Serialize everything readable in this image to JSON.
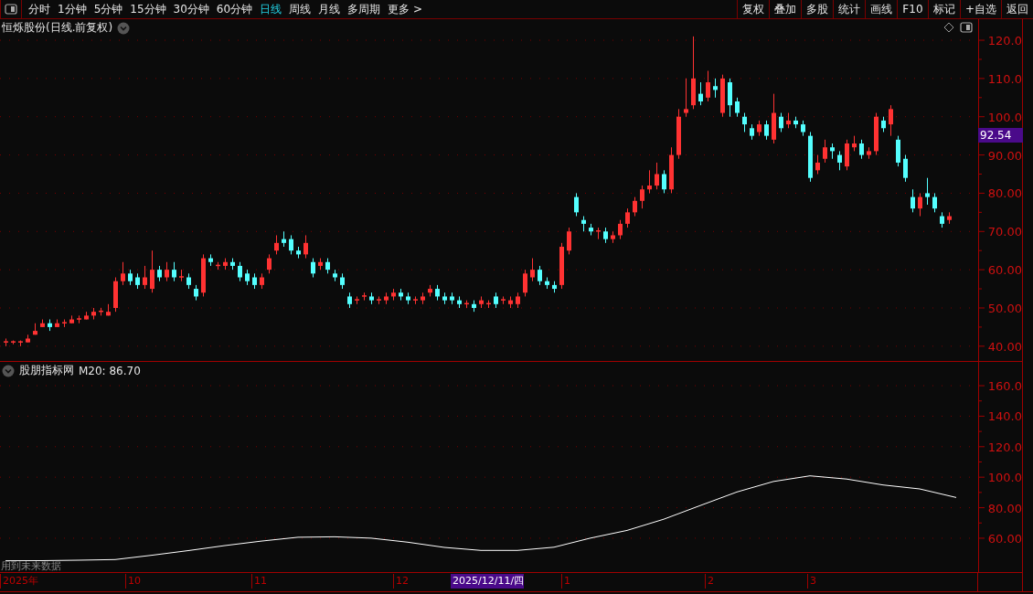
{
  "toolbar": {
    "periods": [
      {
        "label": "分时",
        "selected": false
      },
      {
        "label": "1分钟",
        "selected": false
      },
      {
        "label": "5分钟",
        "selected": false
      },
      {
        "label": "15分钟",
        "selected": false
      },
      {
        "label": "30分钟",
        "selected": false
      },
      {
        "label": "60分钟",
        "selected": false
      },
      {
        "label": "日线",
        "selected": true
      },
      {
        "label": "周线",
        "selected": false
      },
      {
        "label": "月线",
        "selected": false
      },
      {
        "label": "多周期",
        "selected": false
      },
      {
        "label": "更多 >",
        "selected": false
      }
    ],
    "buttons": [
      "复权",
      "叠加",
      "多股",
      "统计",
      "画线",
      "F10",
      "标记",
      "+自选",
      "返回"
    ]
  },
  "price_pane": {
    "title": "恒烁股份(日线.前复权)",
    "last_price": "92.54",
    "chart_data": {
      "type": "candlestick",
      "ylim": [
        35.9,
        125.5
      ],
      "yticks": [
        {
          "value": 120,
          "label": "120.0"
        },
        {
          "value": 110,
          "label": "110.0"
        },
        {
          "value": 100,
          "label": "100.0"
        },
        {
          "value": 90,
          "label": "90.00"
        },
        {
          "value": 80,
          "label": "80.00"
        },
        {
          "value": 70,
          "label": "70.00"
        },
        {
          "value": 60,
          "label": "60.00"
        },
        {
          "value": 50,
          "label": "50.00"
        },
        {
          "value": 40,
          "label": "40.00"
        }
      ],
      "categories": [
        null,
        null,
        null,
        null,
        null,
        null,
        null,
        null,
        null,
        null,
        null,
        null,
        null,
        null,
        null,
        null,
        null,
        null,
        null,
        null,
        null,
        null,
        null,
        null,
        null,
        null,
        null,
        null,
        null,
        null,
        null,
        null,
        null,
        null,
        null,
        null,
        null,
        null,
        null,
        null,
        null,
        null,
        null,
        null,
        null,
        null,
        null,
        null,
        null,
        null,
        null,
        null,
        null,
        null,
        null,
        null,
        null,
        null,
        null,
        null,
        null,
        null,
        null,
        null,
        null,
        null,
        null,
        null,
        null,
        null,
        null,
        null,
        null,
        null,
        null,
        null,
        null,
        null,
        null,
        null,
        null,
        null,
        null,
        null,
        null,
        null,
        null,
        null,
        null,
        null,
        null,
        null,
        null,
        null,
        null,
        null,
        null,
        null,
        null,
        null,
        null,
        null,
        null,
        null,
        null,
        null,
        null,
        null,
        null,
        null,
        null,
        null,
        null,
        null,
        null,
        null,
        null,
        null,
        null,
        null,
        null,
        null,
        null,
        null,
        null,
        null,
        null,
        null,
        null,
        null
      ],
      "grid": true,
      "ohlc": [
        [
          41,
          42,
          40,
          41.3
        ],
        [
          41,
          41.5,
          40.5,
          41.3
        ],
        [
          41,
          41.5,
          40,
          41.3
        ],
        [
          41,
          43,
          41,
          42
        ],
        [
          43,
          46,
          43,
          44
        ],
        [
          45,
          47,
          45,
          46
        ],
        [
          46,
          47,
          44,
          45
        ],
        [
          45,
          47,
          45,
          46
        ],
        [
          46,
          47,
          45,
          46.3
        ],
        [
          46,
          48,
          46,
          47
        ],
        [
          47,
          48,
          46,
          47.3
        ],
        [
          47,
          49,
          47,
          48
        ],
        [
          48,
          50,
          47,
          49
        ],
        [
          49,
          50,
          48,
          49.3
        ],
        [
          48,
          51,
          48,
          49
        ],
        [
          50,
          58,
          49,
          57
        ],
        [
          57,
          62,
          56,
          59
        ],
        [
          59,
          60,
          56,
          57
        ],
        [
          58,
          59,
          55,
          56
        ],
        [
          56,
          61,
          55,
          58
        ],
        [
          55,
          65,
          54,
          60
        ],
        [
          60,
          61,
          57,
          58
        ],
        [
          58,
          62,
          57,
          60
        ],
        [
          60,
          62,
          57,
          58
        ],
        [
          58,
          60,
          57,
          58.3
        ],
        [
          58,
          59,
          55,
          56
        ],
        [
          55,
          56,
          52,
          53
        ],
        [
          54,
          64,
          53,
          63
        ],
        [
          63,
          64,
          61,
          62
        ],
        [
          61,
          62,
          60,
          61.3
        ],
        [
          61,
          63,
          60,
          62
        ],
        [
          62,
          63,
          60,
          61
        ],
        [
          61,
          62,
          57,
          58
        ],
        [
          59,
          60,
          56,
          57
        ],
        [
          58,
          59,
          55,
          56
        ],
        [
          56,
          59,
          55,
          58
        ],
        [
          60,
          64,
          59,
          63
        ],
        [
          65,
          69,
          64,
          67
        ],
        [
          68,
          70,
          66,
          67
        ],
        [
          68,
          69,
          64,
          65
        ],
        [
          65,
          66,
          63,
          64
        ],
        [
          64,
          69,
          63,
          67
        ],
        [
          62,
          63,
          58,
          59
        ],
        [
          61,
          63,
          60,
          62
        ],
        [
          62,
          63,
          59,
          60
        ],
        [
          59,
          60,
          57,
          58
        ],
        [
          58,
          59,
          55,
          56
        ],
        [
          53,
          54,
          50,
          51
        ],
        [
          52,
          53,
          51,
          52.3
        ],
        [
          53,
          54,
          52,
          53.3
        ],
        [
          53,
          54,
          51,
          52
        ],
        [
          52,
          53,
          51,
          52.3
        ],
        [
          52,
          54,
          51,
          53
        ],
        [
          53,
          55,
          52,
          54
        ],
        [
          54,
          55,
          52,
          53
        ],
        [
          53,
          54,
          51,
          52
        ],
        [
          52,
          53,
          51,
          52.3
        ],
        [
          52,
          54,
          51,
          53
        ],
        [
          54,
          56,
          53,
          55
        ],
        [
          55,
          56,
          52,
          53
        ],
        [
          53,
          54,
          51,
          52
        ],
        [
          53,
          54,
          51,
          52
        ],
        [
          52,
          53,
          50,
          51
        ],
        [
          51,
          52,
          50,
          51.3
        ],
        [
          51,
          52,
          49,
          50
        ],
        [
          51,
          53,
          50,
          52
        ],
        [
          51,
          52,
          50,
          51.3
        ],
        [
          53,
          54,
          50,
          51
        ],
        [
          52,
          53,
          51,
          52.3
        ],
        [
          51,
          53,
          50,
          52
        ],
        [
          51,
          54,
          50,
          53
        ],
        [
          54,
          60,
          53,
          59
        ],
        [
          58,
          63,
          57,
          60
        ],
        [
          60,
          61,
          56,
          57
        ],
        [
          57,
          58,
          55,
          56
        ],
        [
          56,
          57,
          54,
          55
        ],
        [
          56,
          67,
          55,
          66
        ],
        [
          65,
          71,
          64,
          70
        ],
        [
          79,
          80,
          74,
          75
        ],
        [
          73,
          74,
          70,
          72
        ],
        [
          71,
          72,
          69,
          70
        ],
        [
          70,
          71,
          68,
          70.3
        ],
        [
          70,
          71,
          67,
          68
        ],
        [
          68,
          70,
          67,
          69
        ],
        [
          69,
          73,
          68,
          72
        ],
        [
          72,
          76,
          71,
          75
        ],
        [
          75,
          79,
          74,
          78
        ],
        [
          78,
          82,
          76,
          81
        ],
        [
          81,
          86,
          80,
          82
        ],
        [
          82,
          88,
          81,
          85
        ],
        [
          85,
          86,
          80,
          81
        ],
        [
          81,
          92,
          80,
          90
        ],
        [
          90,
          102,
          89,
          100
        ],
        [
          101,
          110,
          100,
          102
        ],
        [
          103,
          121,
          102,
          110
        ],
        [
          106,
          109,
          103,
          104
        ],
        [
          105,
          112,
          104,
          109
        ],
        [
          108,
          110,
          105,
          107
        ],
        [
          101,
          111,
          100,
          110
        ],
        [
          109,
          110,
          100,
          103
        ],
        [
          104,
          105,
          100,
          101
        ],
        [
          100,
          101,
          96,
          98
        ],
        [
          97,
          98,
          94,
          95
        ],
        [
          96,
          99,
          95,
          98
        ],
        [
          98,
          99,
          94,
          95
        ],
        [
          94,
          106,
          93,
          101
        ],
        [
          100,
          101,
          96,
          97
        ],
        [
          98,
          101,
          97,
          99
        ],
        [
          99,
          100,
          97,
          98
        ],
        [
          98,
          99,
          95,
          96
        ],
        [
          95,
          96,
          83,
          84
        ],
        [
          86,
          90,
          85,
          88
        ],
        [
          89,
          94,
          88,
          92
        ],
        [
          92,
          93,
          89,
          91
        ],
        [
          90,
          91,
          86,
          88
        ],
        [
          87,
          94,
          86,
          93
        ],
        [
          92,
          95,
          91,
          93
        ],
        [
          93,
          94,
          89,
          90
        ],
        [
          90,
          92,
          89,
          91
        ],
        [
          91,
          101,
          90,
          100
        ],
        [
          99,
          100,
          96,
          97
        ],
        [
          98,
          103,
          95,
          102
        ],
        [
          94,
          95,
          87,
          88
        ],
        [
          89,
          90,
          83,
          84
        ],
        [
          79,
          81,
          75,
          76
        ],
        [
          76,
          80,
          74,
          79
        ],
        [
          80,
          84,
          77,
          79
        ],
        [
          79,
          80,
          75,
          76
        ],
        [
          74,
          75,
          71,
          72
        ],
        [
          73,
          75,
          72,
          74
        ]
      ]
    }
  },
  "indicator_pane": {
    "name": "股朋指标网",
    "reading": "M20: 86.70",
    "note": "用到未来数据",
    "chart_data": {
      "type": "line",
      "ylim": [
        37.2,
        175.6
      ],
      "grid": true,
      "yticks": [
        {
          "value": 160,
          "label": "160.0"
        },
        {
          "value": 140,
          "label": "140.0"
        },
        {
          "value": 120,
          "label": "120.0"
        },
        {
          "value": 100,
          "label": "100.0"
        },
        {
          "value": 80,
          "label": "80.00"
        },
        {
          "value": 60,
          "label": "60.00"
        }
      ],
      "categories": [
        null,
        null,
        null,
        null,
        null,
        null,
        null,
        null,
        null,
        null,
        null,
        null,
        null,
        null,
        null,
        null,
        null,
        null,
        null,
        null,
        null,
        null,
        null,
        null,
        null,
        null,
        null
      ],
      "series": [
        {
          "color": "#ffffff",
          "values": [
            45.2,
            45.3,
            45.6,
            46,
            48.8,
            51.9,
            55.2,
            58.1,
            60.6,
            60.9,
            60,
            57.4,
            54,
            52,
            52,
            54.1,
            60.1,
            65.1,
            72.4,
            81.4,
            90.3,
            97.2,
            100.9,
            98.8,
            94.9,
            92.3,
            86.7
          ]
        }
      ]
    }
  },
  "date_axis": [
    {
      "label": "2025年",
      "selected": false
    },
    {
      "label": "10",
      "selected": false
    },
    {
      "label": "11",
      "selected": false
    },
    {
      "label": "12",
      "selected": false
    },
    {
      "label": "2025/12/11/四",
      "selected": true
    },
    {
      "label": "1",
      "selected": false
    },
    {
      "label": "2",
      "selected": false
    },
    {
      "label": "3",
      "selected": false
    }
  ]
}
